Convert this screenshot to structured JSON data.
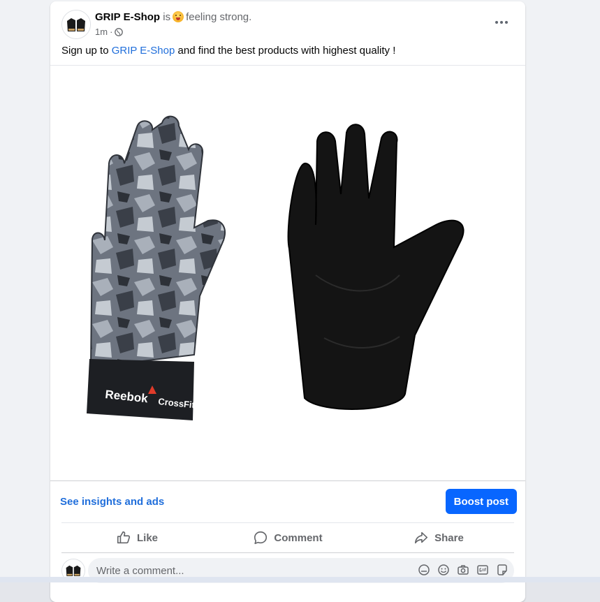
{
  "post": {
    "author": "GRIP E-Shop",
    "activity_prefix": "is",
    "feeling": "feeling strong.",
    "time": "1m",
    "privacy_separator": "·",
    "text_before": "Sign up to",
    "text_link": "GRIP E-Shop",
    "text_after": "and find the best products with highest quality !"
  },
  "product_image": {
    "left_glove_brand": "Reebok",
    "left_glove_brand2": "CrossFit"
  },
  "insights": {
    "link_label": "See insights and ads",
    "boost_label": "Boost post"
  },
  "actions": {
    "like": "Like",
    "comment": "Comment",
    "share": "Share"
  },
  "comment": {
    "placeholder": "Write a comment..."
  },
  "colors": {
    "brand_blue": "#0866ff",
    "link_blue": "#216fdb",
    "muted_text": "#65676b"
  }
}
